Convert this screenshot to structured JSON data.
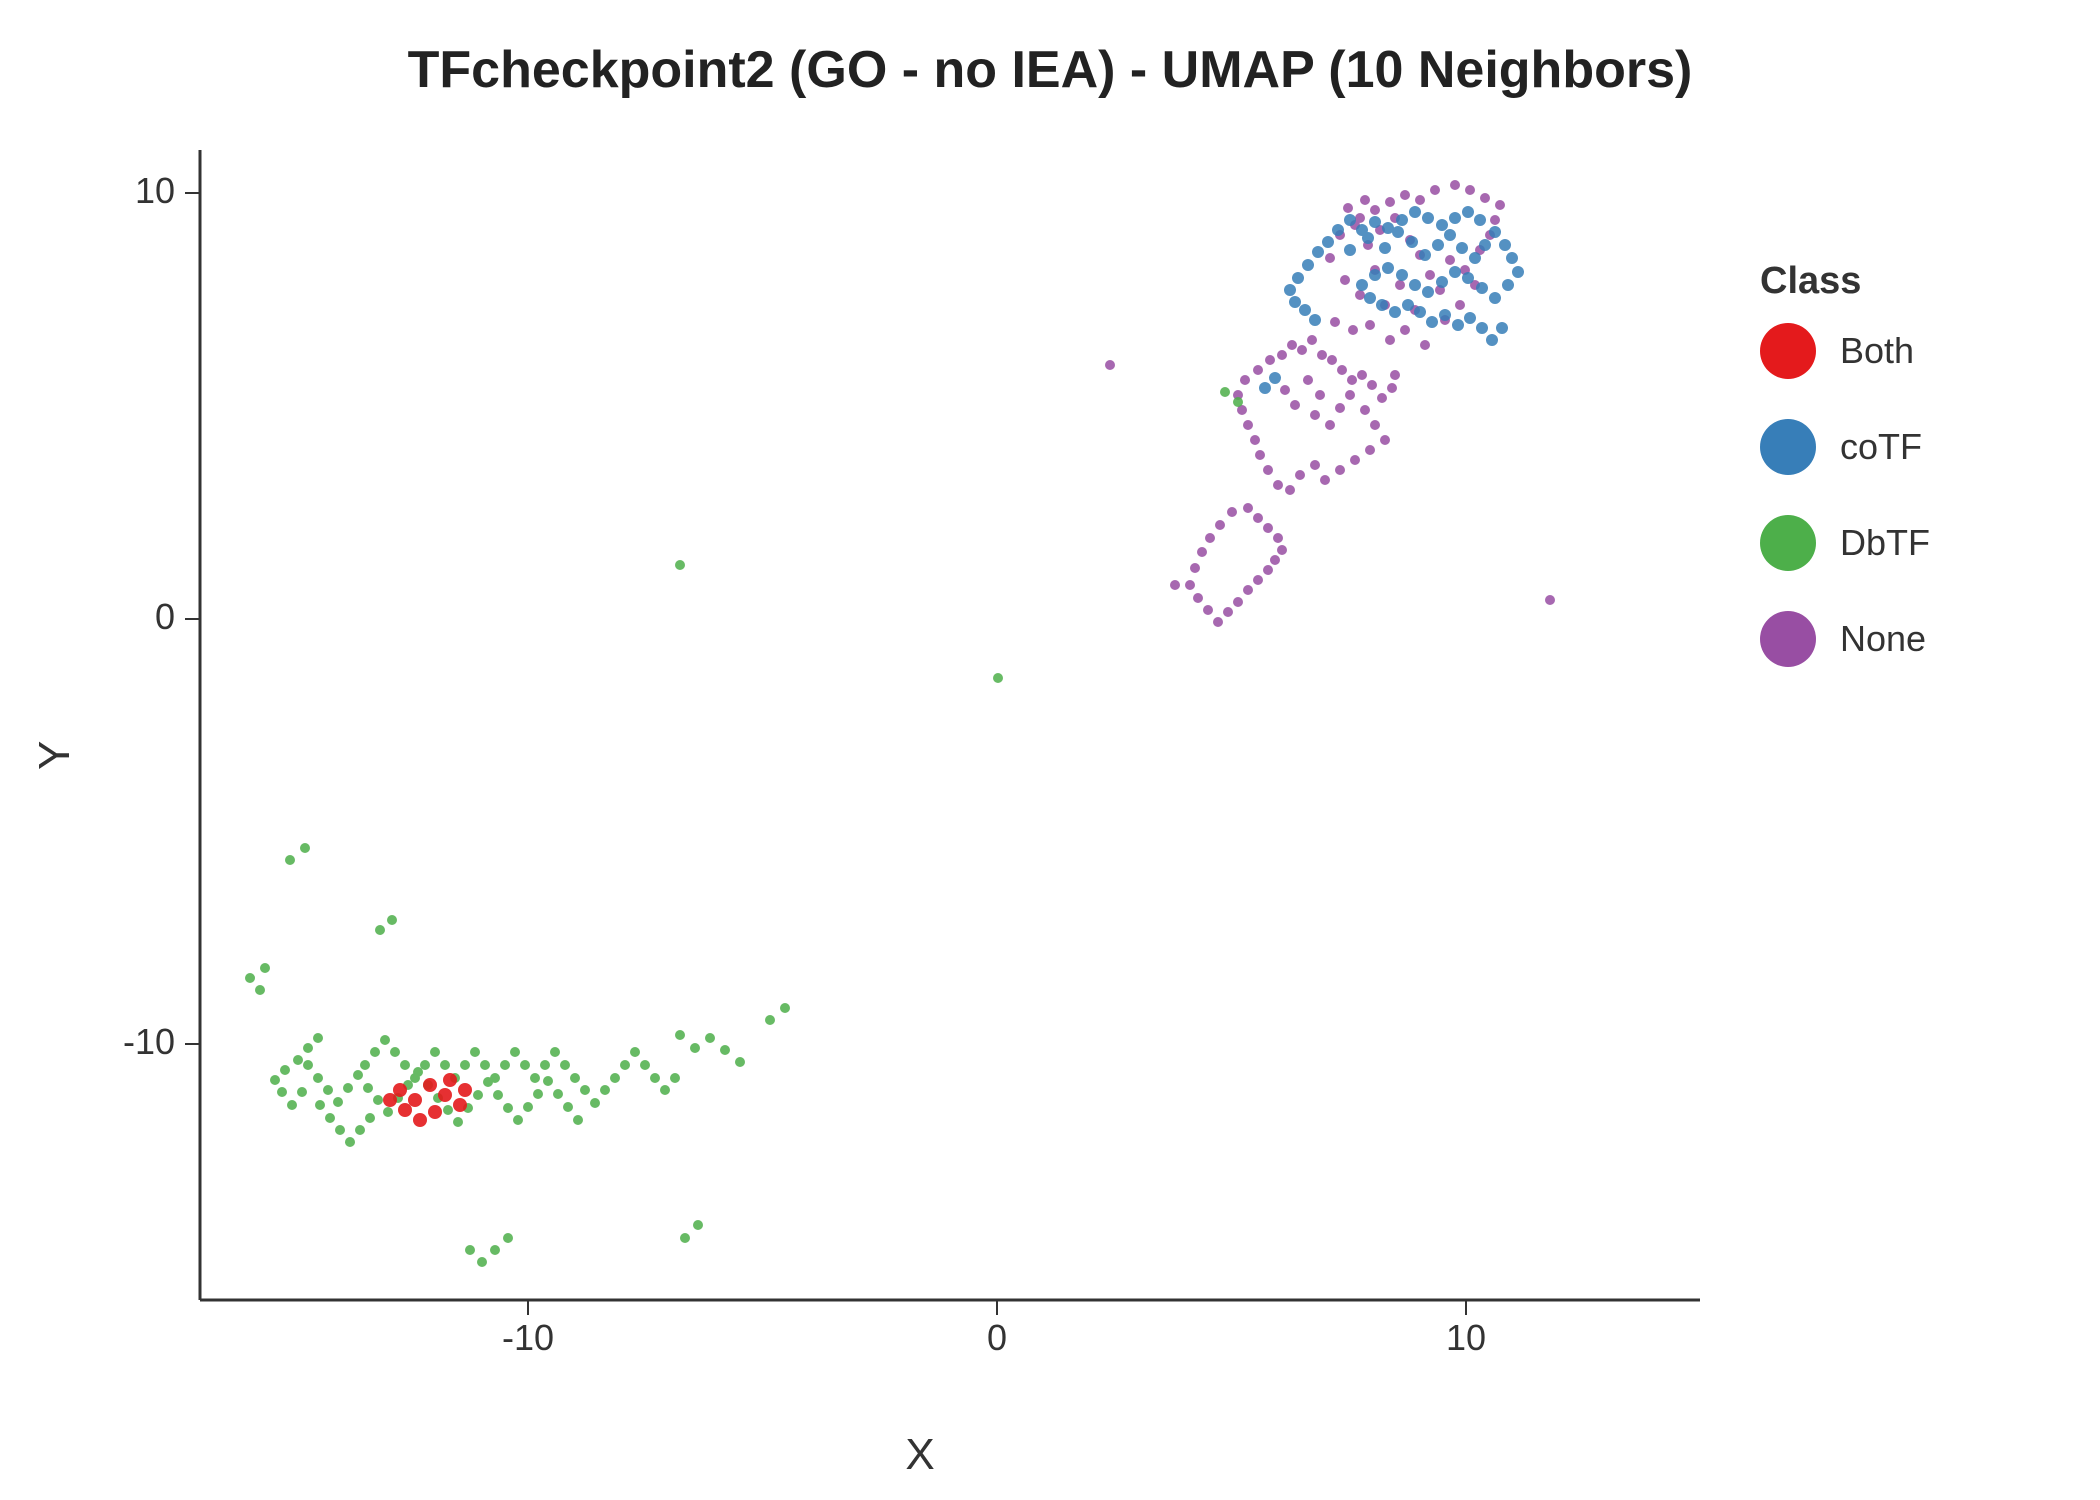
{
  "title": "TFcheckpoint2 (GO - no IEA) - UMAP (10 Neighbors)",
  "axis": {
    "x_label": "X",
    "y_label": "Y",
    "x_min": -17,
    "x_max": 15,
    "y_min": -16,
    "y_max": 11,
    "x_ticks": [
      -10,
      0,
      10
    ],
    "y_ticks": [
      -10,
      0,
      10
    ]
  },
  "legend": {
    "title": "Class",
    "items": [
      {
        "label": "Both",
        "color": "#E41A1C"
      },
      {
        "label": "coTF",
        "color": "#377EB8"
      },
      {
        "label": "DbTF",
        "color": "#4DAF4A"
      },
      {
        "label": "None",
        "color": "#984EA3"
      }
    ]
  }
}
